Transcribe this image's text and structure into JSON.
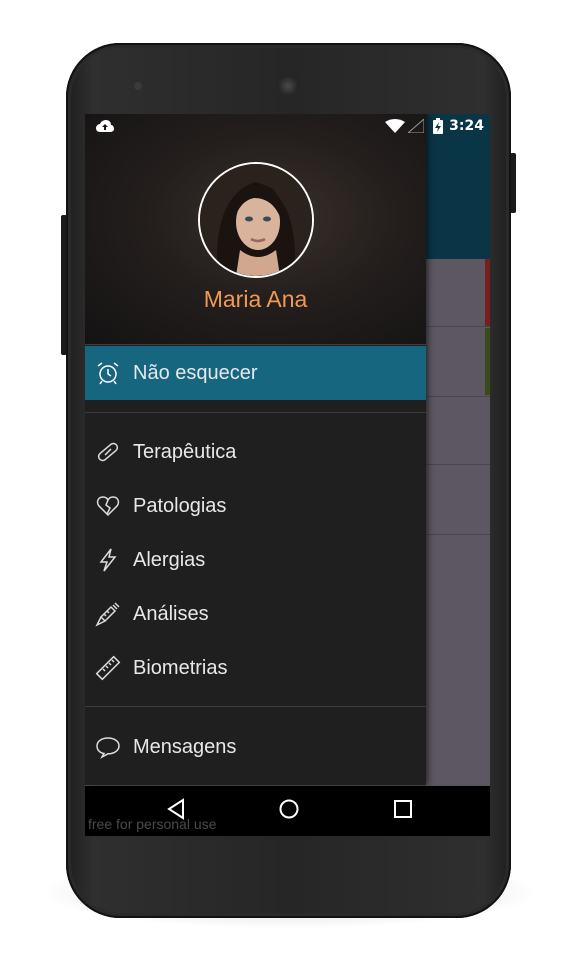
{
  "status_bar": {
    "time": "3:24",
    "icons": [
      "cloud-upload-icon",
      "wifi-icon",
      "signal-icon",
      "battery-charging-icon"
    ]
  },
  "profile": {
    "name": "Maria Ana",
    "avatar": "profile-photo"
  },
  "menu": {
    "highlighted": {
      "label": "Não esquecer",
      "icon": "alarm-clock-icon"
    },
    "items": [
      {
        "label": "Terapêutica",
        "icon": "pill-icon"
      },
      {
        "label": "Patologias",
        "icon": "broken-heart-icon"
      },
      {
        "label": "Alergias",
        "icon": "lightning-icon"
      },
      {
        "label": "Análises",
        "icon": "syringe-icon"
      },
      {
        "label": "Biometrias",
        "icon": "ruler-icon"
      }
    ],
    "footer": {
      "label": "Mensagens",
      "icon": "speech-bubble-icon"
    }
  },
  "navigation": {
    "buttons": [
      "back-icon",
      "home-icon",
      "recents-icon"
    ]
  },
  "watermark": "free for personal use",
  "colors": {
    "accent": "#17667f",
    "name": "#f09a55",
    "drawer_bg": "#1f1f20"
  }
}
